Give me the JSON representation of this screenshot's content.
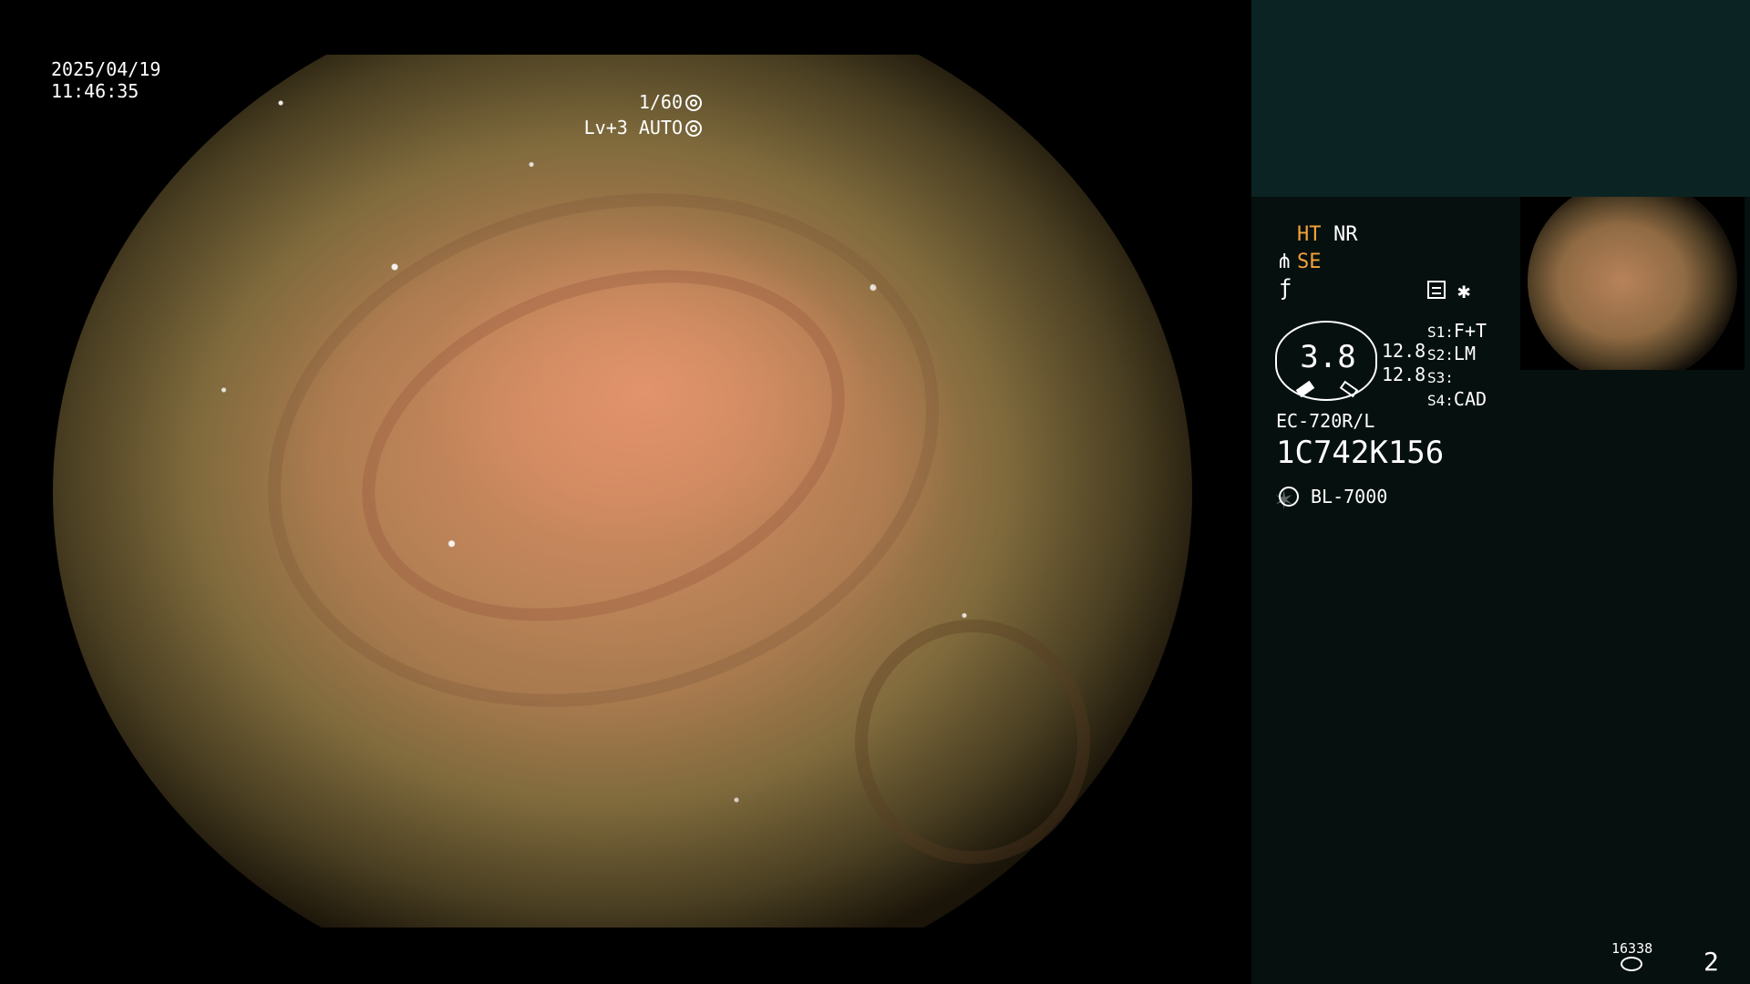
{
  "endoscopy": {
    "date": "2025/04/19",
    "time": "11:46:35",
    "shutter": "1/60",
    "level": "Lv+3 AUTO"
  },
  "panel": {
    "ht": "HT",
    "nr": "NR",
    "se": "SE",
    "gauge_value": "3.8",
    "gauge_top": "12.8",
    "gauge_bottom": "12.8",
    "s1_label": "S1:",
    "s1_value": "F+T",
    "s2_label": "S2:",
    "s2_value": "LM",
    "s3_label": "S3:",
    "s4_label": "S4:",
    "s4_value": "CAD",
    "scope_model": "EC-720R/L",
    "scope_serial": "1C742K156",
    "light_source": "BL-7000",
    "storage_count": "16338",
    "page_number": "2",
    "icons": [
      "aperture-icon",
      "auto-iris-icon",
      "scope-icon",
      "flash-icon",
      "report-icon",
      "asterisk-icon",
      "light-icon",
      "storage-icon"
    ]
  }
}
